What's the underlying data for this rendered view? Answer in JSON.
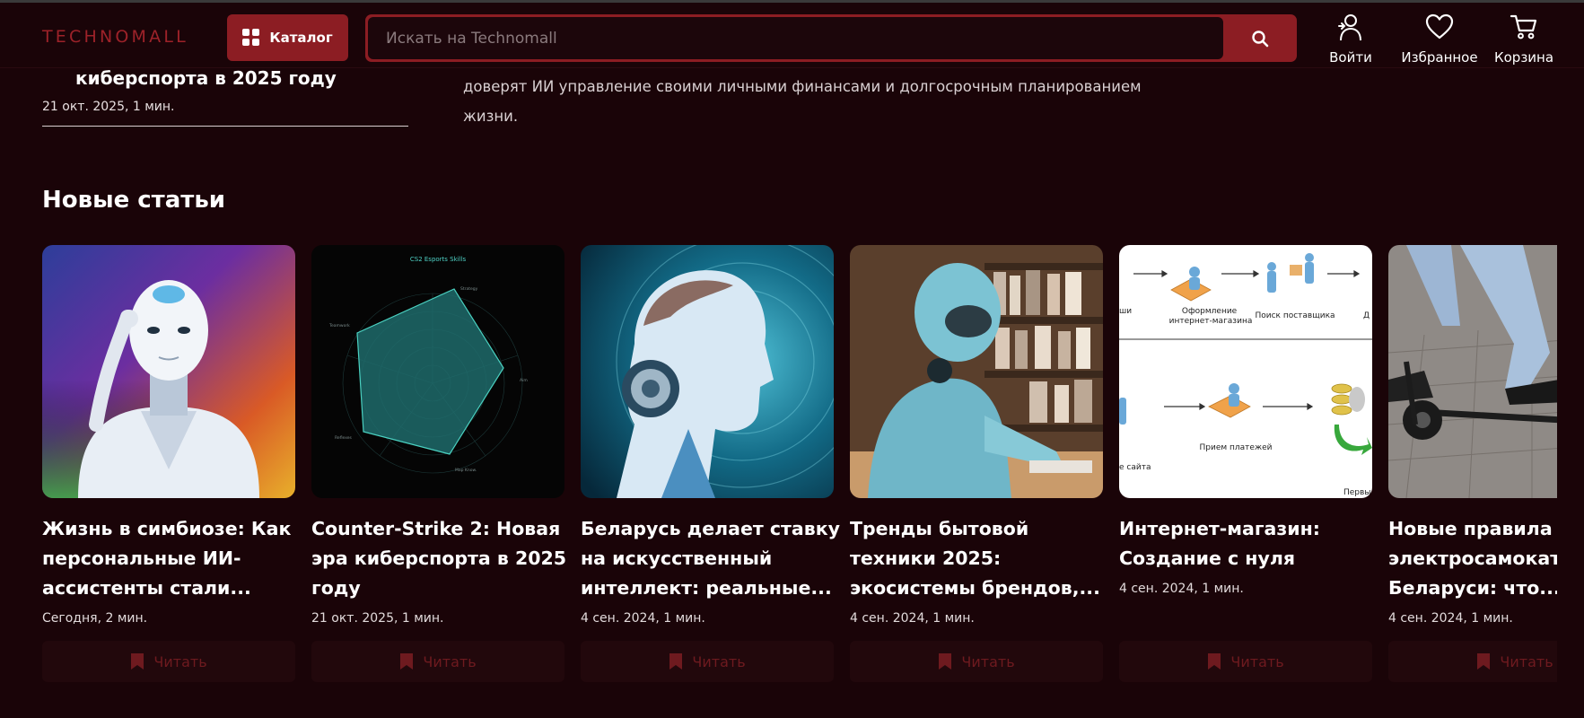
{
  "header": {
    "logo": "TECHNOMALL",
    "catalog_label": "Каталог",
    "search_placeholder": "Искать на Technomall",
    "actions": {
      "login": "Войти",
      "favorites": "Избранное",
      "cart": "Корзина"
    }
  },
  "previous_section": {
    "title_tail": "киберспорта в 2025 году",
    "date": "21 окт. 2025, 1 мин.",
    "text": "доверят ИИ управление своими личными финансами и долгосрочным планированием жизни."
  },
  "section": {
    "title": "Новые статьи",
    "read_label": "Читать",
    "cards": [
      {
        "title": "Жизнь в симбиозе: Как персональные ИИ-ассистенты стали...",
        "meta": "Сегодня, 2 мин."
      },
      {
        "title": "Counter-Strike 2: Новая эра киберспорта в 2025 году",
        "meta": "21 окт. 2025, 1 мин."
      },
      {
        "title": "Беларусь делает ставку на искусственный интеллект: реальные...",
        "meta": "4 сен. 2024, 1 мин."
      },
      {
        "title": "Тренды бытовой техники 2025: экосистемы брендов,...",
        "meta": "4 сен. 2024, 1 мин."
      },
      {
        "title": "Интернет-магазин: Создание с нуля",
        "meta": "4 сен. 2024, 1 мин."
      },
      {
        "title": "Новые правила для электросамокатов в Беларуси: что...",
        "meta": "4 сен. 2024, 1 мин."
      }
    ]
  },
  "thumbnails": {
    "cs2_chart_title": "CS2 Esports Skills",
    "cs2_axes": [
      "Strategy",
      "Aim",
      "Map Know.",
      "Reflexes",
      "Teamwork"
    ],
    "flow_labels": [
      "Оформление интернет-магазина",
      "Поиск поставщика",
      "Прием платежей",
      "е сайта",
      "Первы",
      "ши",
      "Д"
    ]
  },
  "colors": {
    "background": "#1a0408",
    "accent": "#8c1d23",
    "logo": "#9d2229"
  }
}
